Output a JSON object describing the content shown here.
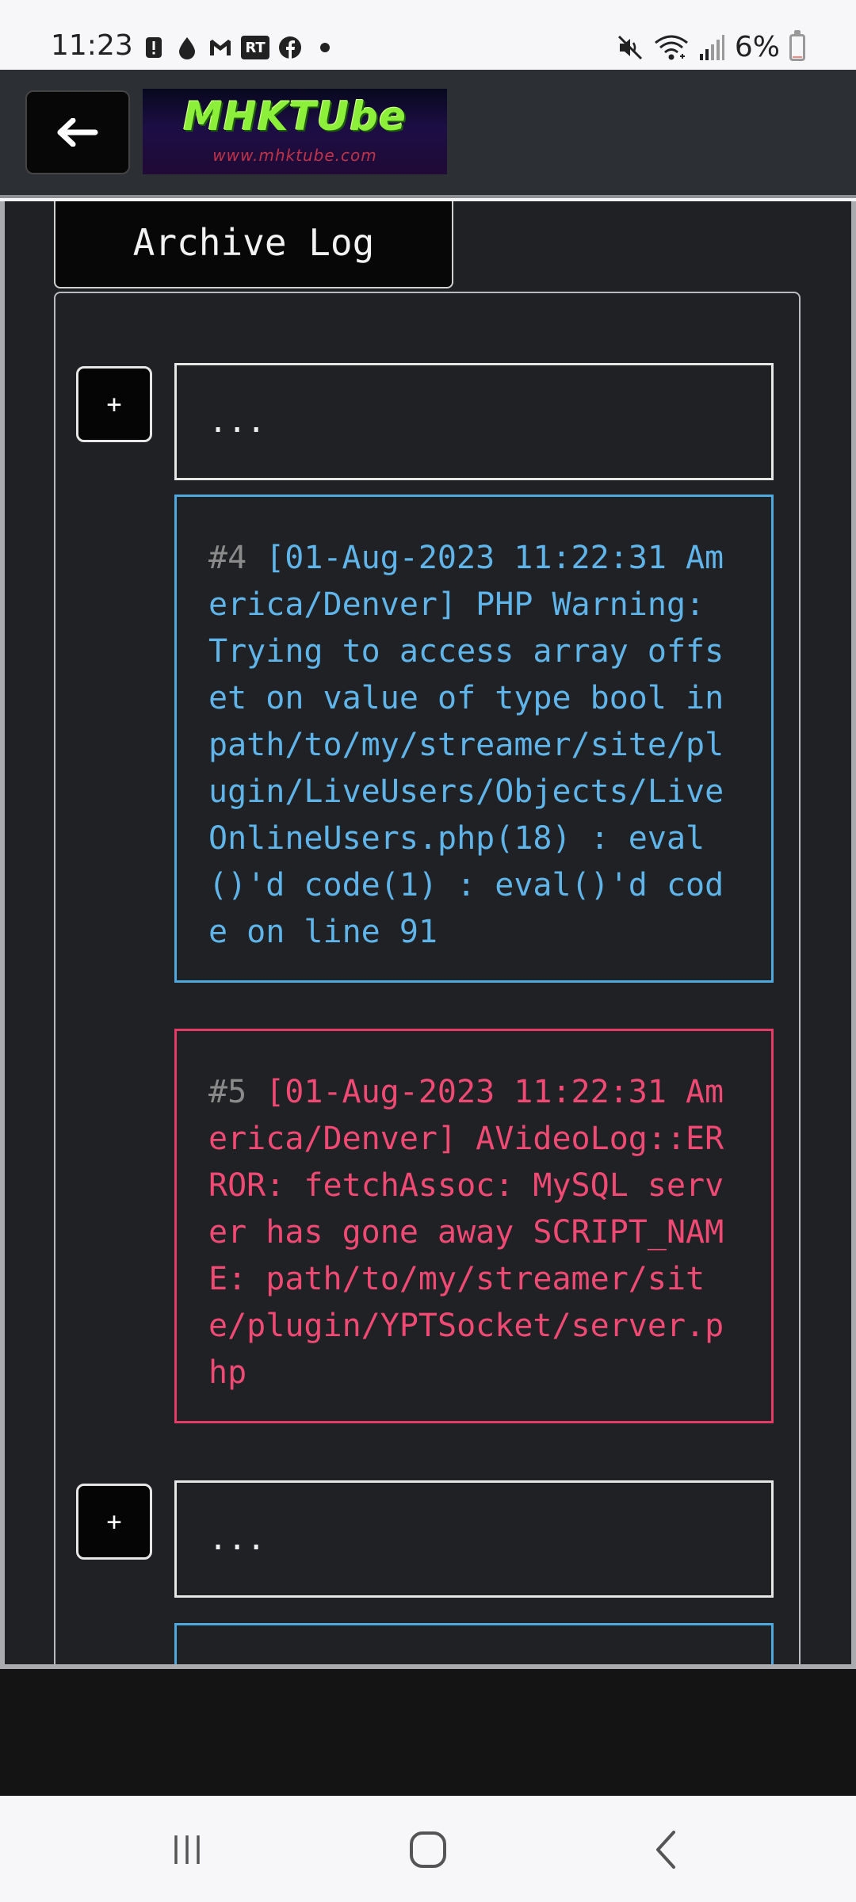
{
  "status_bar": {
    "time": "11:23",
    "battery": "6%",
    "rt_label": "RT",
    "icons_left": [
      "alert-icon",
      "drop-icon",
      "gmail-icon",
      "rt-icon",
      "facebook-icon",
      "dot-icon"
    ],
    "icons_right": [
      "mute-icon",
      "wifi-icon",
      "signal-icon",
      "battery-icon"
    ]
  },
  "header": {
    "logo_title": "MHKTUbe",
    "logo_subtitle": "www.mhktube.com"
  },
  "archive_tab": {
    "label": "Archive Log"
  },
  "log": {
    "ellipsis": "...",
    "plus_label": "+",
    "entries": [
      {
        "num": "#4",
        "type": "warning",
        "text": "[01-Aug-2023 11:22:31 America/Denver] PHP Warning: Trying to access array offset on value of type bool in path/to/my/streamer/site/plugin/LiveUsers/Objects/LiveOnlineUsers.php(18) : eval()'d code(1) : eval()'d code on line 91"
      },
      {
        "num": "#5",
        "type": "error",
        "text": "[01-Aug-2023 11:22:31 America/Denver] AVideoLog::ERROR: fetchAssoc: MySQL server has gone away SCRIPT_NAME: path/to/my/streamer/site/plugin/YPTSocket/server.php"
      }
    ]
  },
  "colors": {
    "warning": "#5fb5ea",
    "error": "#f04a74",
    "header_bg": "#2c2f33",
    "content_bg": "#202124"
  }
}
